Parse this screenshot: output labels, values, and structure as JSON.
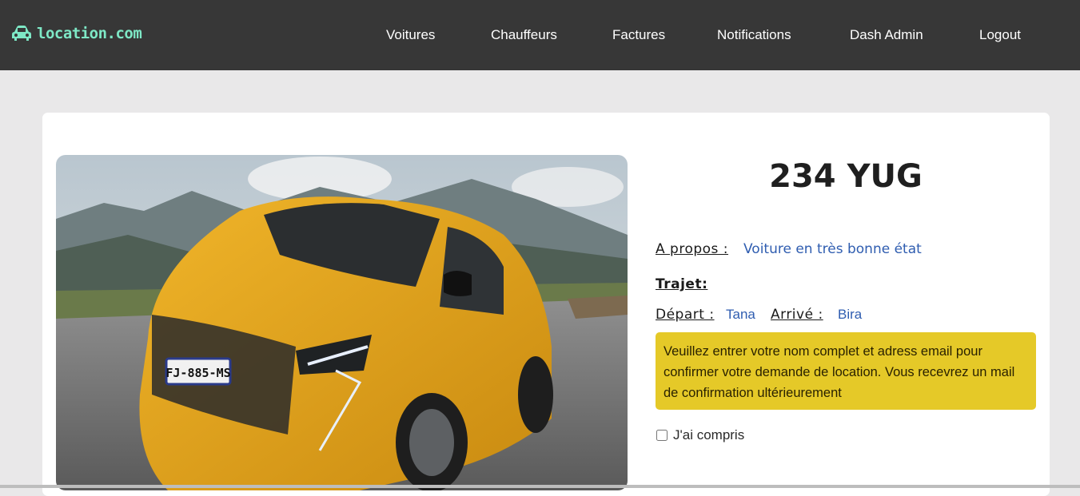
{
  "navbar": {
    "brand": "location.com",
    "links": [
      "Voitures",
      "Chauffeurs",
      "Factures",
      "Notifications",
      "Dash Admin",
      "Logout"
    ]
  },
  "car": {
    "plate": "234 YUG",
    "photo_plate": "FJ-885-MS",
    "about_label": "A propos :",
    "about_value": "Voiture en très bonne état",
    "trajet_label": "Trajet:",
    "depart_label": "Départ :",
    "depart_value": "Tana",
    "arrive_label": "Arrivé :",
    "arrive_value": "Bira"
  },
  "notice": {
    "text": "Veuillez entrer votre nom complet et adress email pour confirmer votre demande de location. Vous recevrez un mail de confirmation ultérieurement"
  },
  "confirm": {
    "label": "J'ai compris",
    "checked": false
  },
  "colors": {
    "navbar": "#373737",
    "brand": "#7ee8c6",
    "accent_text": "#2f5db0",
    "notice_bg": "#e5c928",
    "car_body": "#e0a21a"
  }
}
